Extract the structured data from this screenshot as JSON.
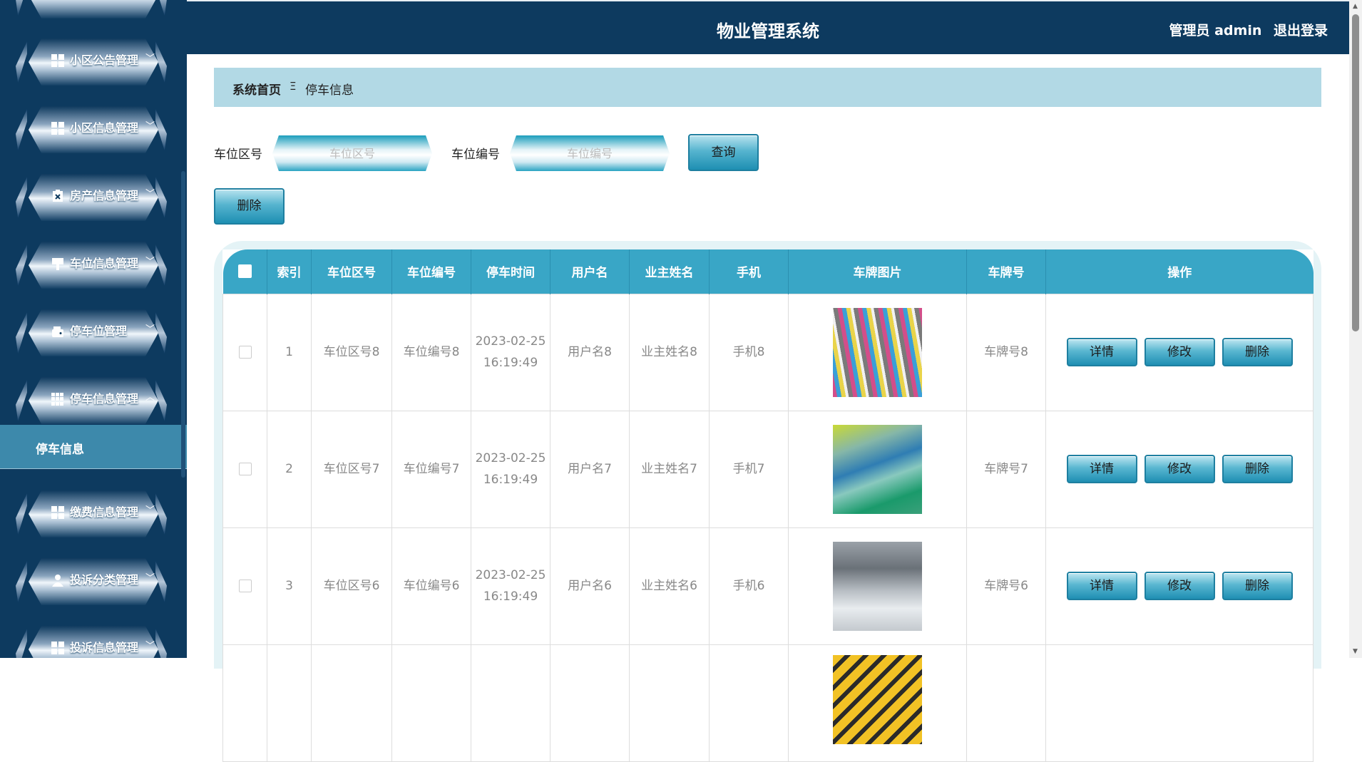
{
  "header": {
    "title": "物业管理系统",
    "role": "管理员 admin",
    "logout": "退出登录"
  },
  "sidebar": {
    "items": [
      {
        "label": "小区公告管理",
        "icon": "grid-icon"
      },
      {
        "label": "小区信息管理",
        "icon": "grid-icon"
      },
      {
        "label": "房产信息管理",
        "icon": "clipboard-icon"
      },
      {
        "label": "车位信息管理",
        "icon": "sign-icon"
      },
      {
        "label": "停车位管理",
        "icon": "wallet-icon"
      },
      {
        "label": "停车信息管理",
        "icon": "grid-nine-icon"
      },
      {
        "label": "缴费信息管理",
        "icon": "grid-icon"
      },
      {
        "label": "投诉分类管理",
        "icon": "user-icon"
      },
      {
        "label": "投诉信息管理",
        "icon": "grid-icon"
      }
    ],
    "active_sub": "停车信息"
  },
  "breadcrumb": {
    "home": "系统首页",
    "separator": "Ξ",
    "current": "停车信息"
  },
  "search": {
    "area_label": "车位区号",
    "area_placeholder": "车位区号",
    "number_label": "车位编号",
    "number_placeholder": "车位编号",
    "query_button": "查询"
  },
  "toolbar": {
    "delete_button": "删除"
  },
  "table": {
    "headers": [
      "",
      "索引",
      "车位区号",
      "车位编号",
      "停车时间",
      "用户名",
      "业主姓名",
      "手机",
      "车牌图片",
      "车牌号",
      "操作"
    ],
    "rows": [
      {
        "index": "1",
        "area": "车位区号8",
        "number": "车位编号8",
        "time": "2023-02-25 16:19:49",
        "username": "用户名8",
        "owner": "业主姓名8",
        "phone": "手机8",
        "plate": "车牌号8"
      },
      {
        "index": "2",
        "area": "车位区号7",
        "number": "车位编号7",
        "time": "2023-02-25 16:19:49",
        "username": "用户名7",
        "owner": "业主姓名7",
        "phone": "手机7",
        "plate": "车牌号7"
      },
      {
        "index": "3",
        "area": "车位区号6",
        "number": "车位编号6",
        "time": "2023-02-25 16:19:49",
        "username": "用户名6",
        "owner": "业主姓名6",
        "phone": "手机6",
        "plate": "车牌号6"
      }
    ],
    "actions": {
      "detail": "详情",
      "edit": "修改",
      "delete": "删除"
    }
  },
  "colors": {
    "navy": "#0d3a5f",
    "accent": "#39a6c6",
    "breadcrumb_bg": "#b2d9e5",
    "submenu_bg": "#3d89ab"
  }
}
